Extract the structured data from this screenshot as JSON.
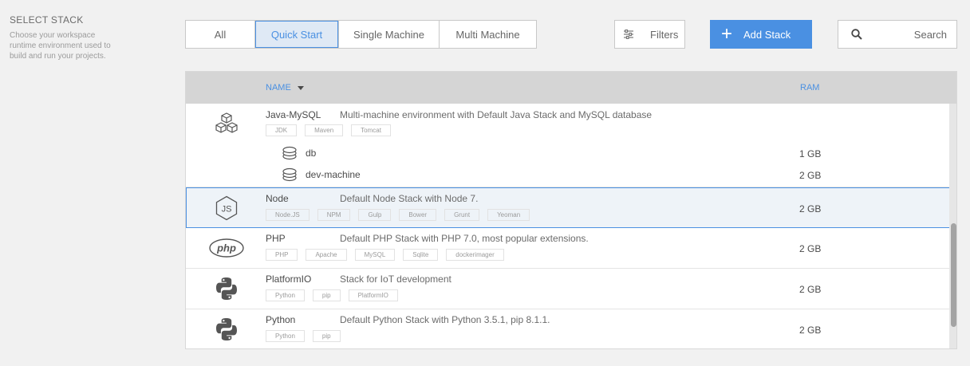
{
  "sidebar": {
    "title": "SELECT STACK",
    "description": "Choose your workspace runtime environment used to build and run your projects."
  },
  "filters": [
    {
      "label": "All",
      "active": false
    },
    {
      "label": "Quick Start",
      "active": true
    },
    {
      "label": "Single Machine",
      "active": false
    },
    {
      "label": "Multi Machine",
      "active": false
    }
  ],
  "toolbar": {
    "filters_label": "Filters",
    "add_label": "Add Stack",
    "search_placeholder": "Search"
  },
  "table": {
    "columns": {
      "name": "NAME",
      "ram": "RAM"
    },
    "stacks": [
      {
        "name": "Java-MySQL",
        "description": "Multi-machine environment with Default Java Stack and MySQL database",
        "icon": "cubes-icon",
        "tags": [
          "JDK",
          "Maven",
          "Tomcat"
        ],
        "ram": "",
        "machines": [
          {
            "name": "db",
            "ram": "1 GB"
          },
          {
            "name": "dev-machine",
            "ram": "2 GB"
          }
        ]
      },
      {
        "name": "Node",
        "description": "Default Node Stack with Node 7.",
        "icon": "nodejs-icon",
        "tags": [
          "Node.JS",
          "NPM",
          "Gulp",
          "Bower",
          "Grunt",
          "Yeoman"
        ],
        "ram": "2 GB",
        "selected": true
      },
      {
        "name": "PHP",
        "description": "Default PHP Stack with PHP 7.0, most popular extensions.",
        "icon": "php-icon",
        "tags": [
          "PHP",
          "Apache",
          "MySQL",
          "Sqlite",
          "dockerimager"
        ],
        "ram": "2 GB"
      },
      {
        "name": "PlatformIO",
        "description": "Stack for IoT development",
        "icon": "python-icon",
        "tags": [
          "Python",
          "pip",
          "PlatformIO"
        ],
        "ram": "2 GB"
      },
      {
        "name": "Python",
        "description": "Default Python Stack with Python 3.5.1, pip 8.1.1.",
        "icon": "python-icon",
        "tags": [
          "Python",
          "pip"
        ],
        "ram": "2 GB"
      }
    ]
  },
  "colors": {
    "accent": "#4a90e2",
    "selected_row": "#eef3f8",
    "header_bg": "#d5d5d5"
  }
}
